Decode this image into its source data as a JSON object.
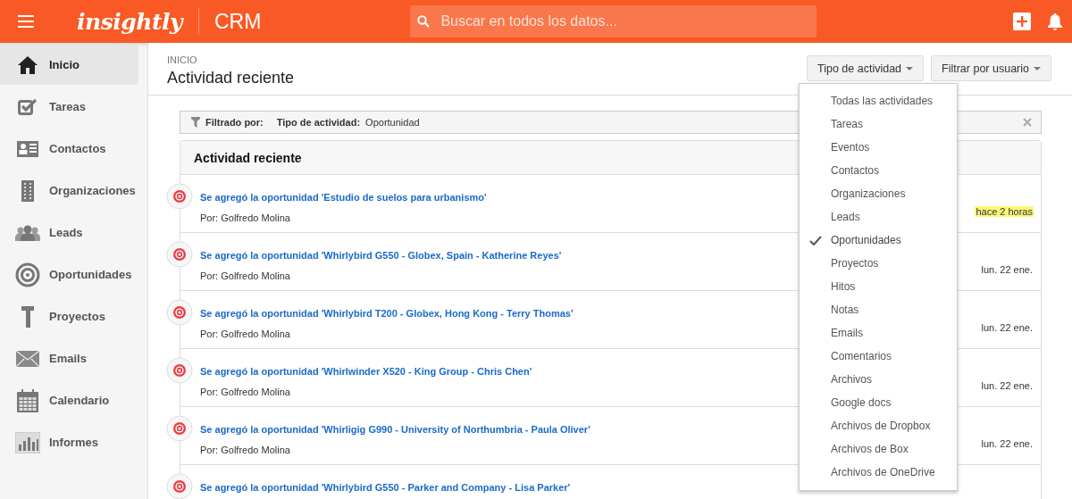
{
  "header": {
    "logo": "insightly",
    "app": "CRM",
    "search": {
      "placeholder": "Buscar en todos los datos..."
    }
  },
  "sidebar": {
    "items": [
      {
        "label": "Inicio",
        "selected": true
      },
      {
        "label": "Tareas",
        "selected": false
      },
      {
        "label": "Contactos",
        "selected": false
      },
      {
        "label": "Organizaciones",
        "selected": false
      },
      {
        "label": "Leads",
        "selected": false
      },
      {
        "label": "Oportunidades",
        "selected": false
      },
      {
        "label": "Proyectos",
        "selected": false
      },
      {
        "label": "Emails",
        "selected": false
      },
      {
        "label": "Calendario",
        "selected": false
      },
      {
        "label": "Informes",
        "selected": false
      }
    ]
  },
  "page": {
    "breadcrumb": "INICIO",
    "title": "Actividad reciente",
    "buttons": [
      "Tipo de actividad",
      "Filtrar por usuario"
    ]
  },
  "filter": {
    "label": "Filtrado por:",
    "key": "Tipo de actividad:",
    "value": "Oportunidad"
  },
  "feed": {
    "title": "Actividad reciente",
    "rows": [
      {
        "title": "Se agregó la oportunidad 'Estudio de suelos para urbanismo'",
        "author": "Por: Golfredo Molina",
        "time": "hace 2 horas",
        "highlighted": true
      },
      {
        "title": "Se agregó la oportunidad 'Whirlybird G550 - Globex, Spain - Katherine Reyes'",
        "author": "Por: Golfredo Molina",
        "time": "lun. 22 ene.",
        "highlighted": false
      },
      {
        "title": "Se agregó la oportunidad 'Whirlybird T200 - Globex, Hong Kong - Terry Thomas'",
        "author": "Por: Golfredo Molina",
        "time": "lun. 22 ene.",
        "highlighted": false
      },
      {
        "title": "Se agregó la oportunidad 'Whirlwinder X520 - King Group - Chris Chen'",
        "author": "Por: Golfredo Molina",
        "time": "lun. 22 ene.",
        "highlighted": false
      },
      {
        "title": "Se agregó la oportunidad 'Whirligig G990 - University of Northumbria - Paula Oliver'",
        "author": "Por: Golfredo Molina",
        "time": "lun. 22 ene.",
        "highlighted": false
      },
      {
        "title": "Se agregó la oportunidad 'Whirlybird G550 - Parker and Company - Lisa Parker'"
      }
    ]
  },
  "dropdown": {
    "items": [
      {
        "label": "Todas las actividades",
        "selected": false
      },
      {
        "label": "Tareas",
        "selected": false
      },
      {
        "label": "Eventos",
        "selected": false
      },
      {
        "label": "Contactos",
        "selected": false
      },
      {
        "label": "Organizaciones",
        "selected": false
      },
      {
        "label": "Leads",
        "selected": false
      },
      {
        "label": "Oportunidades",
        "selected": true
      },
      {
        "label": "Proyectos",
        "selected": false
      },
      {
        "label": "Hitos",
        "selected": false
      },
      {
        "label": "Notas",
        "selected": false
      },
      {
        "label": "Emails",
        "selected": false
      },
      {
        "label": "Comentarios",
        "selected": false
      },
      {
        "label": "Archivos",
        "selected": false
      },
      {
        "label": "Google docs",
        "selected": false
      },
      {
        "label": "Archivos de Dropbox",
        "selected": false
      },
      {
        "label": "Archivos de Box",
        "selected": false
      },
      {
        "label": "Archivos de OneDrive",
        "selected": false
      }
    ]
  }
}
